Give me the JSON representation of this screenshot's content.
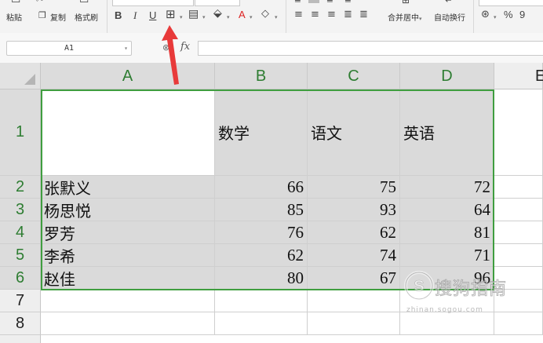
{
  "ribbon": {
    "paste_label": "粘贴",
    "copy_label": "复制",
    "format_painter_label": "格式刷",
    "bold": "B",
    "italic": "I",
    "underline": "U",
    "merge_center_label": "合并居中",
    "wrap_text_label": "自动换行",
    "percent": "%",
    "comma_style": "9"
  },
  "formula_bar": {
    "name_box": "A1",
    "fx": "fx",
    "formula": ""
  },
  "columns": [
    "A",
    "B",
    "C",
    "D",
    "E"
  ],
  "rows": [
    "1",
    "2",
    "3",
    "4",
    "5",
    "6",
    "7",
    "8"
  ],
  "header_row": [
    "",
    "数学",
    "语文",
    "英语"
  ],
  "table": [
    {
      "name": "张默义",
      "math": "66",
      "chinese": "75",
      "english": "72"
    },
    {
      "name": "杨思悦",
      "math": "85",
      "chinese": "93",
      "english": "64"
    },
    {
      "name": "罗芳",
      "math": "76",
      "chinese": "62",
      "english": "81"
    },
    {
      "name": "李希",
      "math": "62",
      "chinese": "74",
      "english": "71"
    },
    {
      "name": "赵佳",
      "math": "80",
      "chinese": "67",
      "english": "96"
    }
  ],
  "watermark": {
    "brand": "搜狗指南",
    "url": "zhinan.sogou.com"
  },
  "colors": {
    "selection_border": "#3f9e3f",
    "selected_header_text": "#2e7d32",
    "annotation_arrow": "#e83a3a"
  }
}
